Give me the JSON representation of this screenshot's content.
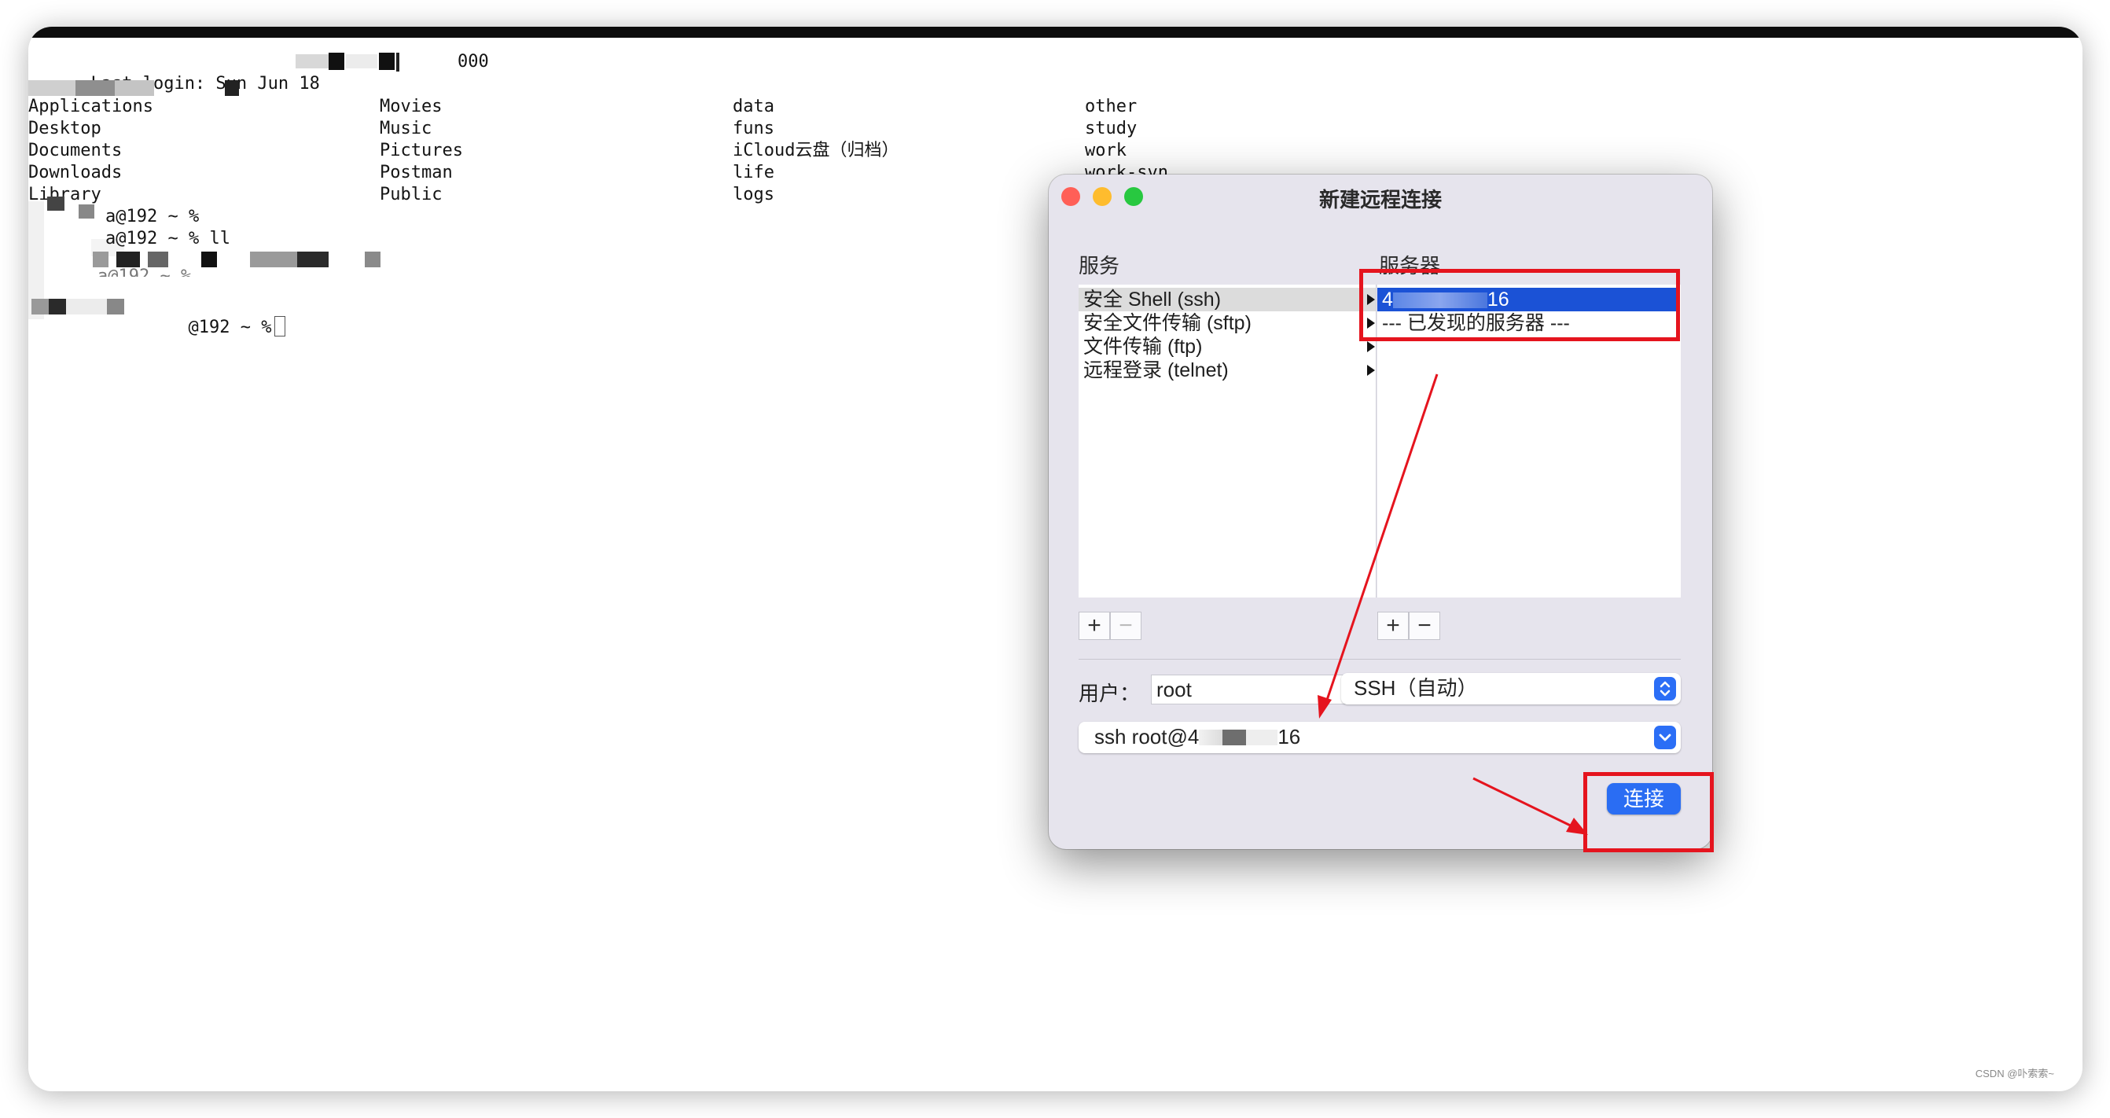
{
  "terminal": {
    "last_login": "Last login: Sun Jun 18 ",
    "last_login_tail": "000",
    "ls_columns": [
      [
        "Applications",
        "Desktop",
        "Documents",
        "Downloads",
        "Library"
      ],
      [
        "Movies",
        "Music",
        "Pictures",
        "Postman",
        "Public"
      ],
      [
        "data",
        "funs",
        "iCloud云盘（归档）",
        "life",
        "logs"
      ],
      [
        "other",
        "study",
        "work",
        "work-svn"
      ]
    ],
    "prompts": [
      "a@192 ~ %",
      "a@192 ~ % ll",
      "a@192 ~ %",
      "@192 ~ %"
    ]
  },
  "dialog": {
    "title": "新建远程连接",
    "services_header": "服务",
    "servers_header": "服务器",
    "services": [
      "安全 Shell (ssh)",
      "安全文件传输 (sftp)",
      "文件传输 (ftp)",
      "远程登录 (telnet)"
    ],
    "servers": [
      {
        "prefix": "4",
        "suffix": "16"
      },
      {
        "label": "--- 已发现的服务器 ---"
      }
    ],
    "plus_label": "+",
    "minus_label": "−",
    "user_label": "用户：",
    "user_value": "root",
    "protocol_value": "SSH（自动）",
    "command_prefix": "ssh root@4",
    "command_suffix": "16",
    "connect_label": "连接"
  },
  "watermark": "CSDN @卟索索~",
  "colors": {
    "close": "#ff5f57",
    "minimize": "#febc2e",
    "zoom": "#28c840",
    "accent": "#2a6df3",
    "selection": "#1b52d6",
    "annotation": "#e5141e"
  }
}
